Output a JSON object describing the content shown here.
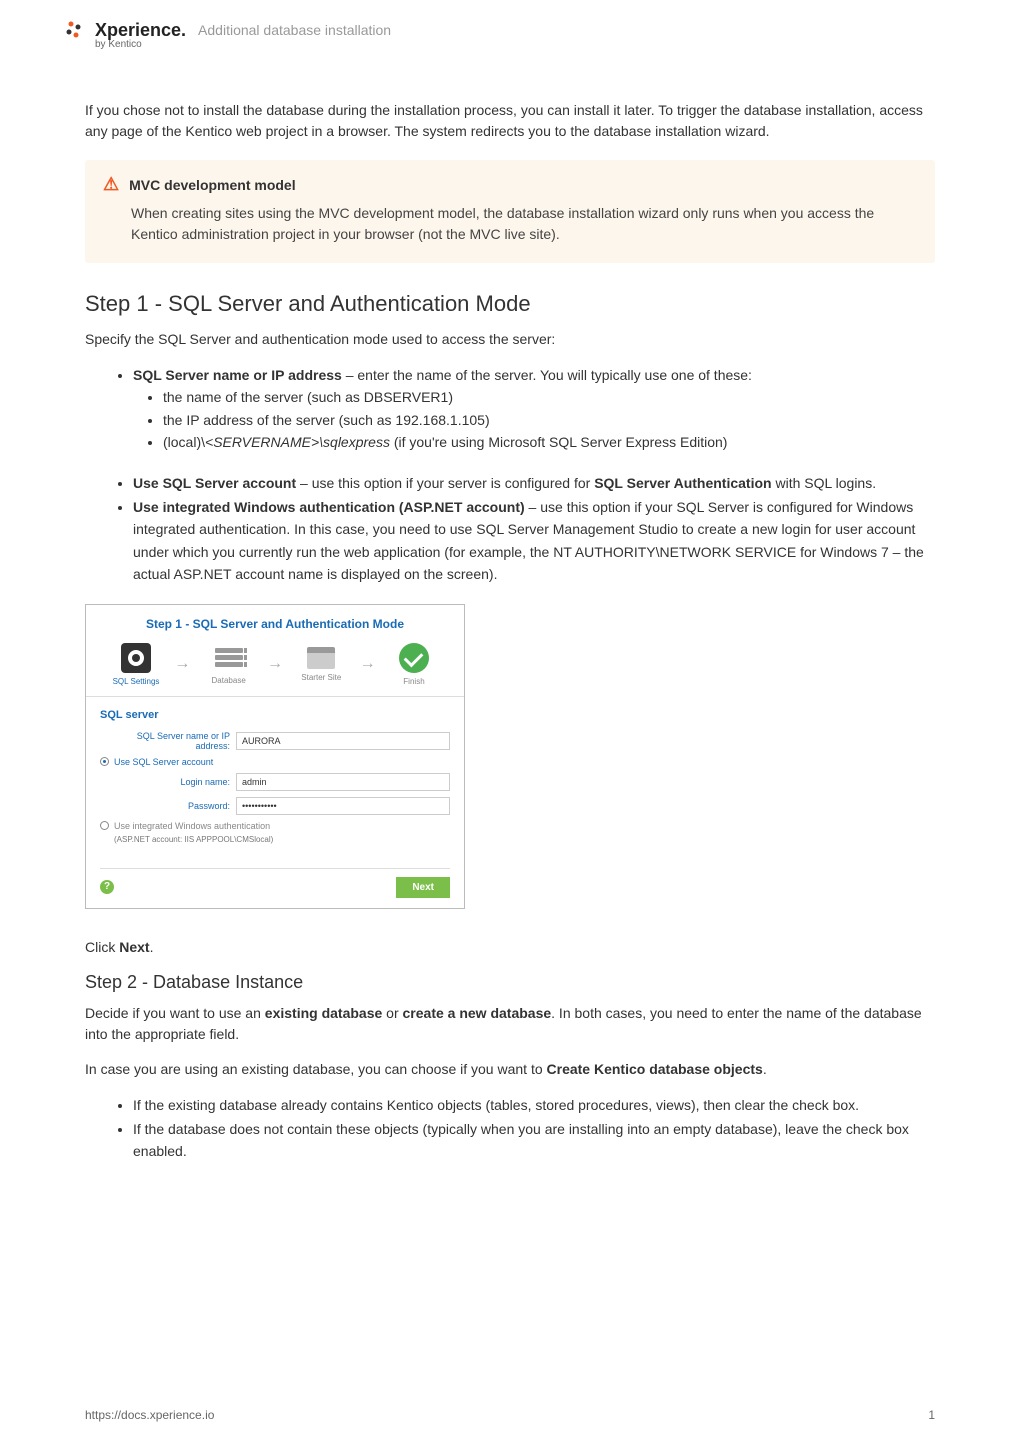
{
  "header": {
    "brand_main": "Xperience.",
    "brand_sub": "by Kentico",
    "breadcrumb": "Additional database installation"
  },
  "intro": "If you chose not to install the database during the installation process, you can install it later. To trigger the database installation, access any page of the Kentico web project in a browser. The system redirects you to the database installation wizard.",
  "note": {
    "title": "MVC development model",
    "body": "When creating sites using the MVC development model, the database installation wizard only runs when you access the Kentico administration project in your browser (not the MVC live site)."
  },
  "step1": {
    "heading": "Step 1 - SQL Server and Authentication Mode",
    "lead": "Specify the SQL Server and authentication mode used to access the server:",
    "bullet_name_label": "SQL Server name or IP address",
    "bullet_name_text": " – enter the name of the server. You will typically use one of these:",
    "sub_a": "the name of the server (such as DBSERVER1)",
    "sub_b": "the IP address of the server (such as 192.168.1.105)",
    "sub_c_pre": "(local)\\",
    "sub_c_em_server": "<SERVERNAME>",
    "sub_c_em_sql": "\\sqlexpress",
    "sub_c_post": " (if you're using Microsoft SQL Server Express Edition)",
    "bullet_usesql_label": "Use SQL Server account",
    "bullet_usesql_text_a": " – use this option if your server is configured for ",
    "bullet_usesql_bold": "SQL Server Authentication",
    "bullet_usesql_text_b": " with SQL logins.",
    "bullet_winauth_label": "Use integrated Windows authentication (ASP.NET account)",
    "bullet_winauth_text": " – use this option if your SQL Server is configured for Windows integrated authentication. In this case, you need to use SQL Server Management Studio to create a new login for user account under which you currently run the web application (for example, the NT AUTHORITY\\NETWORK SERVICE for Windows 7 – the actual ASP.NET account name is displayed on the screen).",
    "click_next_pre": "Click ",
    "click_next_bold": "Next",
    "click_next_post": "."
  },
  "wizard": {
    "title": "Step 1 - SQL Server and Authentication Mode",
    "steps": {
      "sql": "SQL Settings",
      "db": "Database",
      "site": "Starter Site",
      "finish": "Finish"
    },
    "section": "SQL server",
    "field_server_label": "SQL Server name or IP address:",
    "field_server_value": "AURORA",
    "radio_sql": "Use SQL Server account",
    "login_label": "Login name:",
    "login_value": "admin",
    "password_label": "Password:",
    "password_value": "•••••••••••",
    "radio_win": "Use integrated Windows authentication",
    "win_sub": "(ASP.NET account: IIS APPPOOL\\CMSlocal)",
    "help": "?",
    "next": "Next"
  },
  "step2": {
    "heading": "Step 2 - Database Instance",
    "lead_a": "Decide if you want to use an ",
    "lead_b_bold": "existing database",
    "lead_c": " or ",
    "lead_d_bold": "create a new database",
    "lead_e": ". In both cases, you need to enter the name of the database into the appropriate field.",
    "para2_a": "In case you are using an existing database, you can choose if you want to ",
    "para2_bold": "Create Kentico database objects",
    "para2_b": ".",
    "bullet1": "If the existing database already contains Kentico objects (tables, stored procedures, views), then clear the check box.",
    "bullet2": "If the database does not contain these objects (typically when you are installing into an empty database), leave the check box enabled."
  },
  "footer": {
    "url": "https://docs.xperience.io",
    "page": "1"
  }
}
